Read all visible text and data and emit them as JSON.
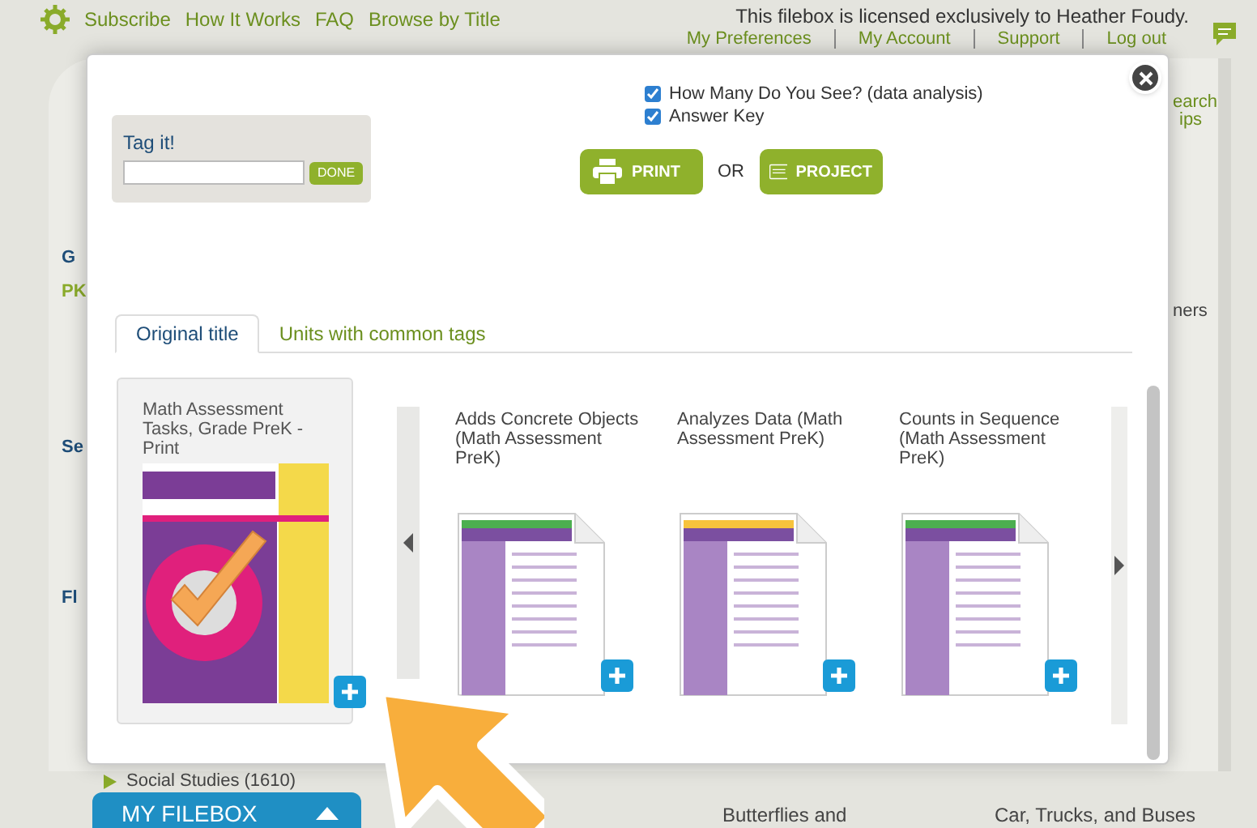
{
  "nav": {
    "links": [
      "Subscribe",
      "How It Works",
      "FAQ",
      "Browse by Title"
    ],
    "license": "This filebox is licensed exclusively to Heather Foudy.",
    "account_links": [
      "My Preferences",
      "My Account",
      "Support",
      "Log out"
    ]
  },
  "background": {
    "left_fragments": [
      "G",
      "PK",
      "Se",
      "Fl"
    ],
    "search_tips": [
      "earch",
      "ips"
    ],
    "right_fragment": "ners",
    "tree_item": "Social Studies (1610)",
    "filebox_tab": "MY FILEBOX",
    "cards": [
      "Butterflies and",
      "Car, Trucks, and Buses"
    ]
  },
  "modal": {
    "tag": {
      "label": "Tag it!",
      "button": "DONE"
    },
    "options": [
      {
        "label": "How Many Do You See? (data analysis)",
        "checked": true
      },
      {
        "label": "Answer Key",
        "checked": true
      }
    ],
    "actions": {
      "print": "PRINT",
      "or": "OR",
      "project": "PROJECT"
    },
    "tabs": [
      {
        "label": "Original title",
        "selected": true
      },
      {
        "label": "Units with common tags",
        "selected": false
      }
    ],
    "original": {
      "title": "Math Assessment Tasks, Grade PreK - Print"
    },
    "units": [
      {
        "title": "Adds Concrete Objects (Math Assessment PreK)",
        "color": "#4caf50"
      },
      {
        "title": "Analyzes Data (Math Assessment PreK)",
        "color": "#f7c33c"
      },
      {
        "title": "Counts in Sequence (Math Assessment PreK)",
        "color": "#4caf50"
      }
    ]
  }
}
